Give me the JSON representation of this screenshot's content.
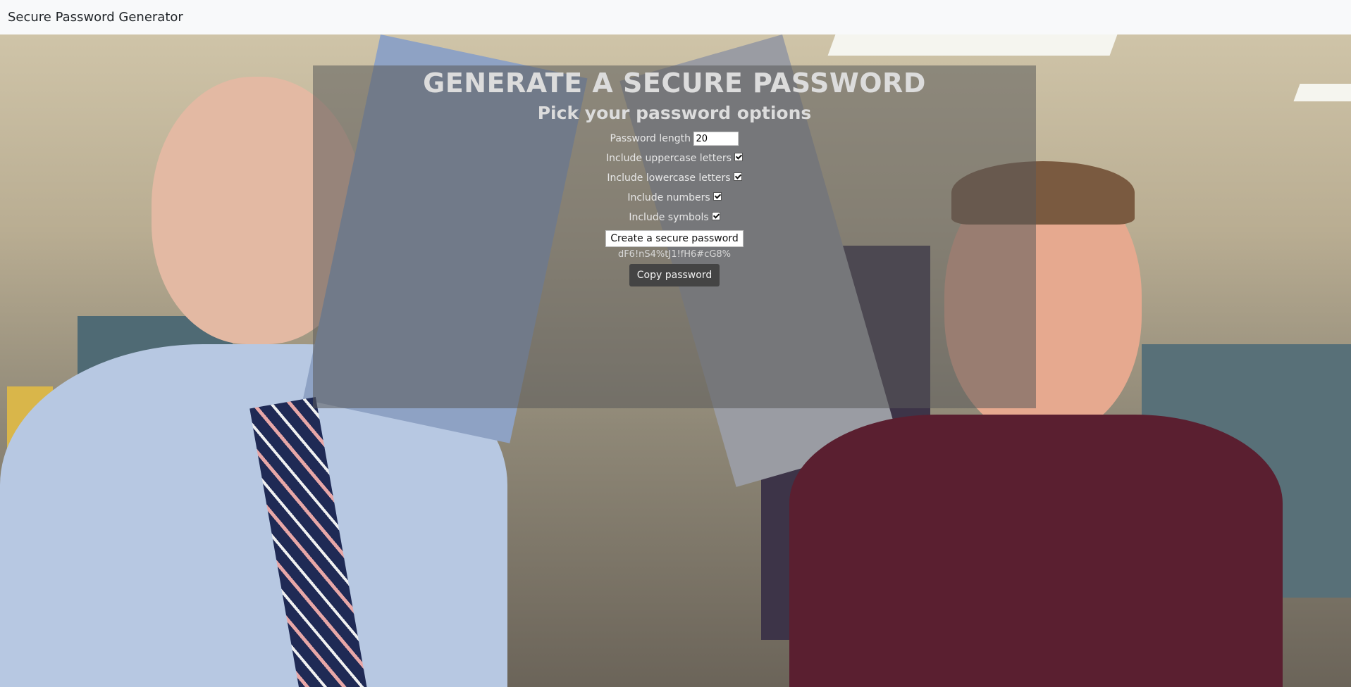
{
  "navbar": {
    "brand": "Secure Password Generator"
  },
  "main": {
    "title": "GENERATE A SECURE PASSWORD",
    "subtitle": "Pick your password options",
    "length_label": "Password length",
    "length_value": "20",
    "uppercase_label": "Include uppercase letters",
    "uppercase_checked": true,
    "lowercase_label": "Include lowercase letters",
    "lowercase_checked": true,
    "numbers_label": "Include numbers",
    "numbers_checked": true,
    "symbols_label": "Include symbols",
    "symbols_checked": true,
    "create_button": "Create a secure password",
    "generated_password": "dF6!nS4%tJ1!fH6#cG8%",
    "copy_button": "Copy password"
  },
  "colors": {
    "navbar_bg": "#f8f9fa",
    "panel_overlay": "rgba(90,90,90,0.55)",
    "copy_button_bg": "#444444"
  }
}
